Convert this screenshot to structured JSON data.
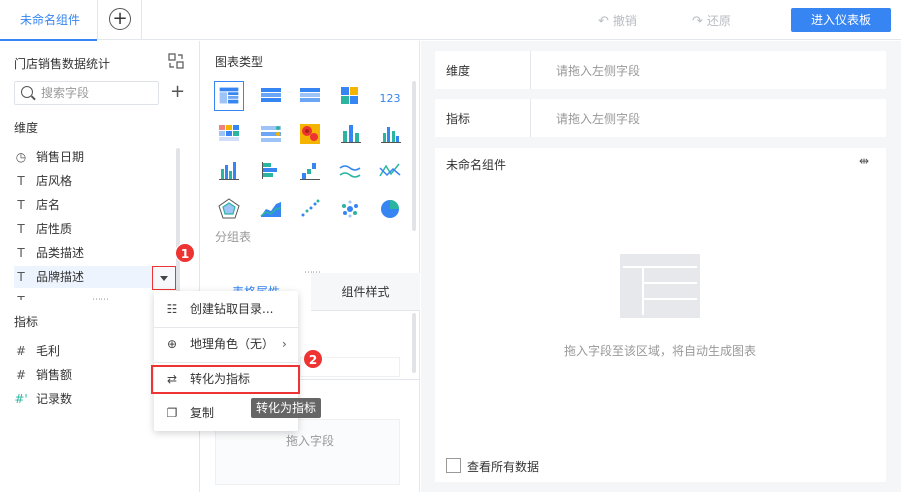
{
  "topbar": {
    "tab_label": "未命名组件",
    "undo_label": "撤销",
    "redo_label": "还原",
    "enter_dashboard_label": "进入仪表板"
  },
  "left": {
    "dataset_title": "门店销售数据统计",
    "search_placeholder": "搜索字段",
    "dimension_label": "维度",
    "dimensions": [
      {
        "label": "销售日期",
        "icon": "clock-icon"
      },
      {
        "label": "店风格",
        "icon": "text-field-icon"
      },
      {
        "label": "店名",
        "icon": "text-field-icon"
      },
      {
        "label": "店性质",
        "icon": "text-field-icon"
      },
      {
        "label": "品类描述",
        "icon": "text-field-icon"
      },
      {
        "label": "品牌描述",
        "icon": "text-field-icon"
      }
    ],
    "indicator_label": "指标",
    "indicators": [
      {
        "label": "毛利",
        "icon": "number-field-icon"
      },
      {
        "label": "销售额",
        "icon": "number-field-icon"
      },
      {
        "label": "记录数",
        "icon": "number-field-icon"
      }
    ]
  },
  "middle": {
    "chart_type_title": "图表类型",
    "group_label": "分组表",
    "tab_table_attr": "表格属性",
    "tab_component_style": "组件样式",
    "drop_field_hint": "拖入字段"
  },
  "right": {
    "dimension_label": "维度",
    "dimension_placeholder": "请拖入左侧字段",
    "indicator_label": "指标",
    "indicator_placeholder": "请拖入左侧字段",
    "component_name": "未命名组件",
    "empty_hint": "拖入字段至该区域，将自动生成图表",
    "show_all_label": "查看所有数据"
  },
  "context_menu": {
    "items": [
      {
        "label": "创建钻取目录...",
        "icon": "drill-icon"
      },
      {
        "label": "地理角色（无）",
        "icon": "globe-icon"
      },
      {
        "label": "转化为指标",
        "icon": "swap-icon"
      },
      {
        "label": "复制",
        "icon": "copy-icon"
      }
    ],
    "tooltip": "转化为指标"
  },
  "annotations": {
    "badge1": "1",
    "badge2": "2"
  },
  "colors": {
    "accent": "#3685f2",
    "highlight": "#e33333"
  }
}
